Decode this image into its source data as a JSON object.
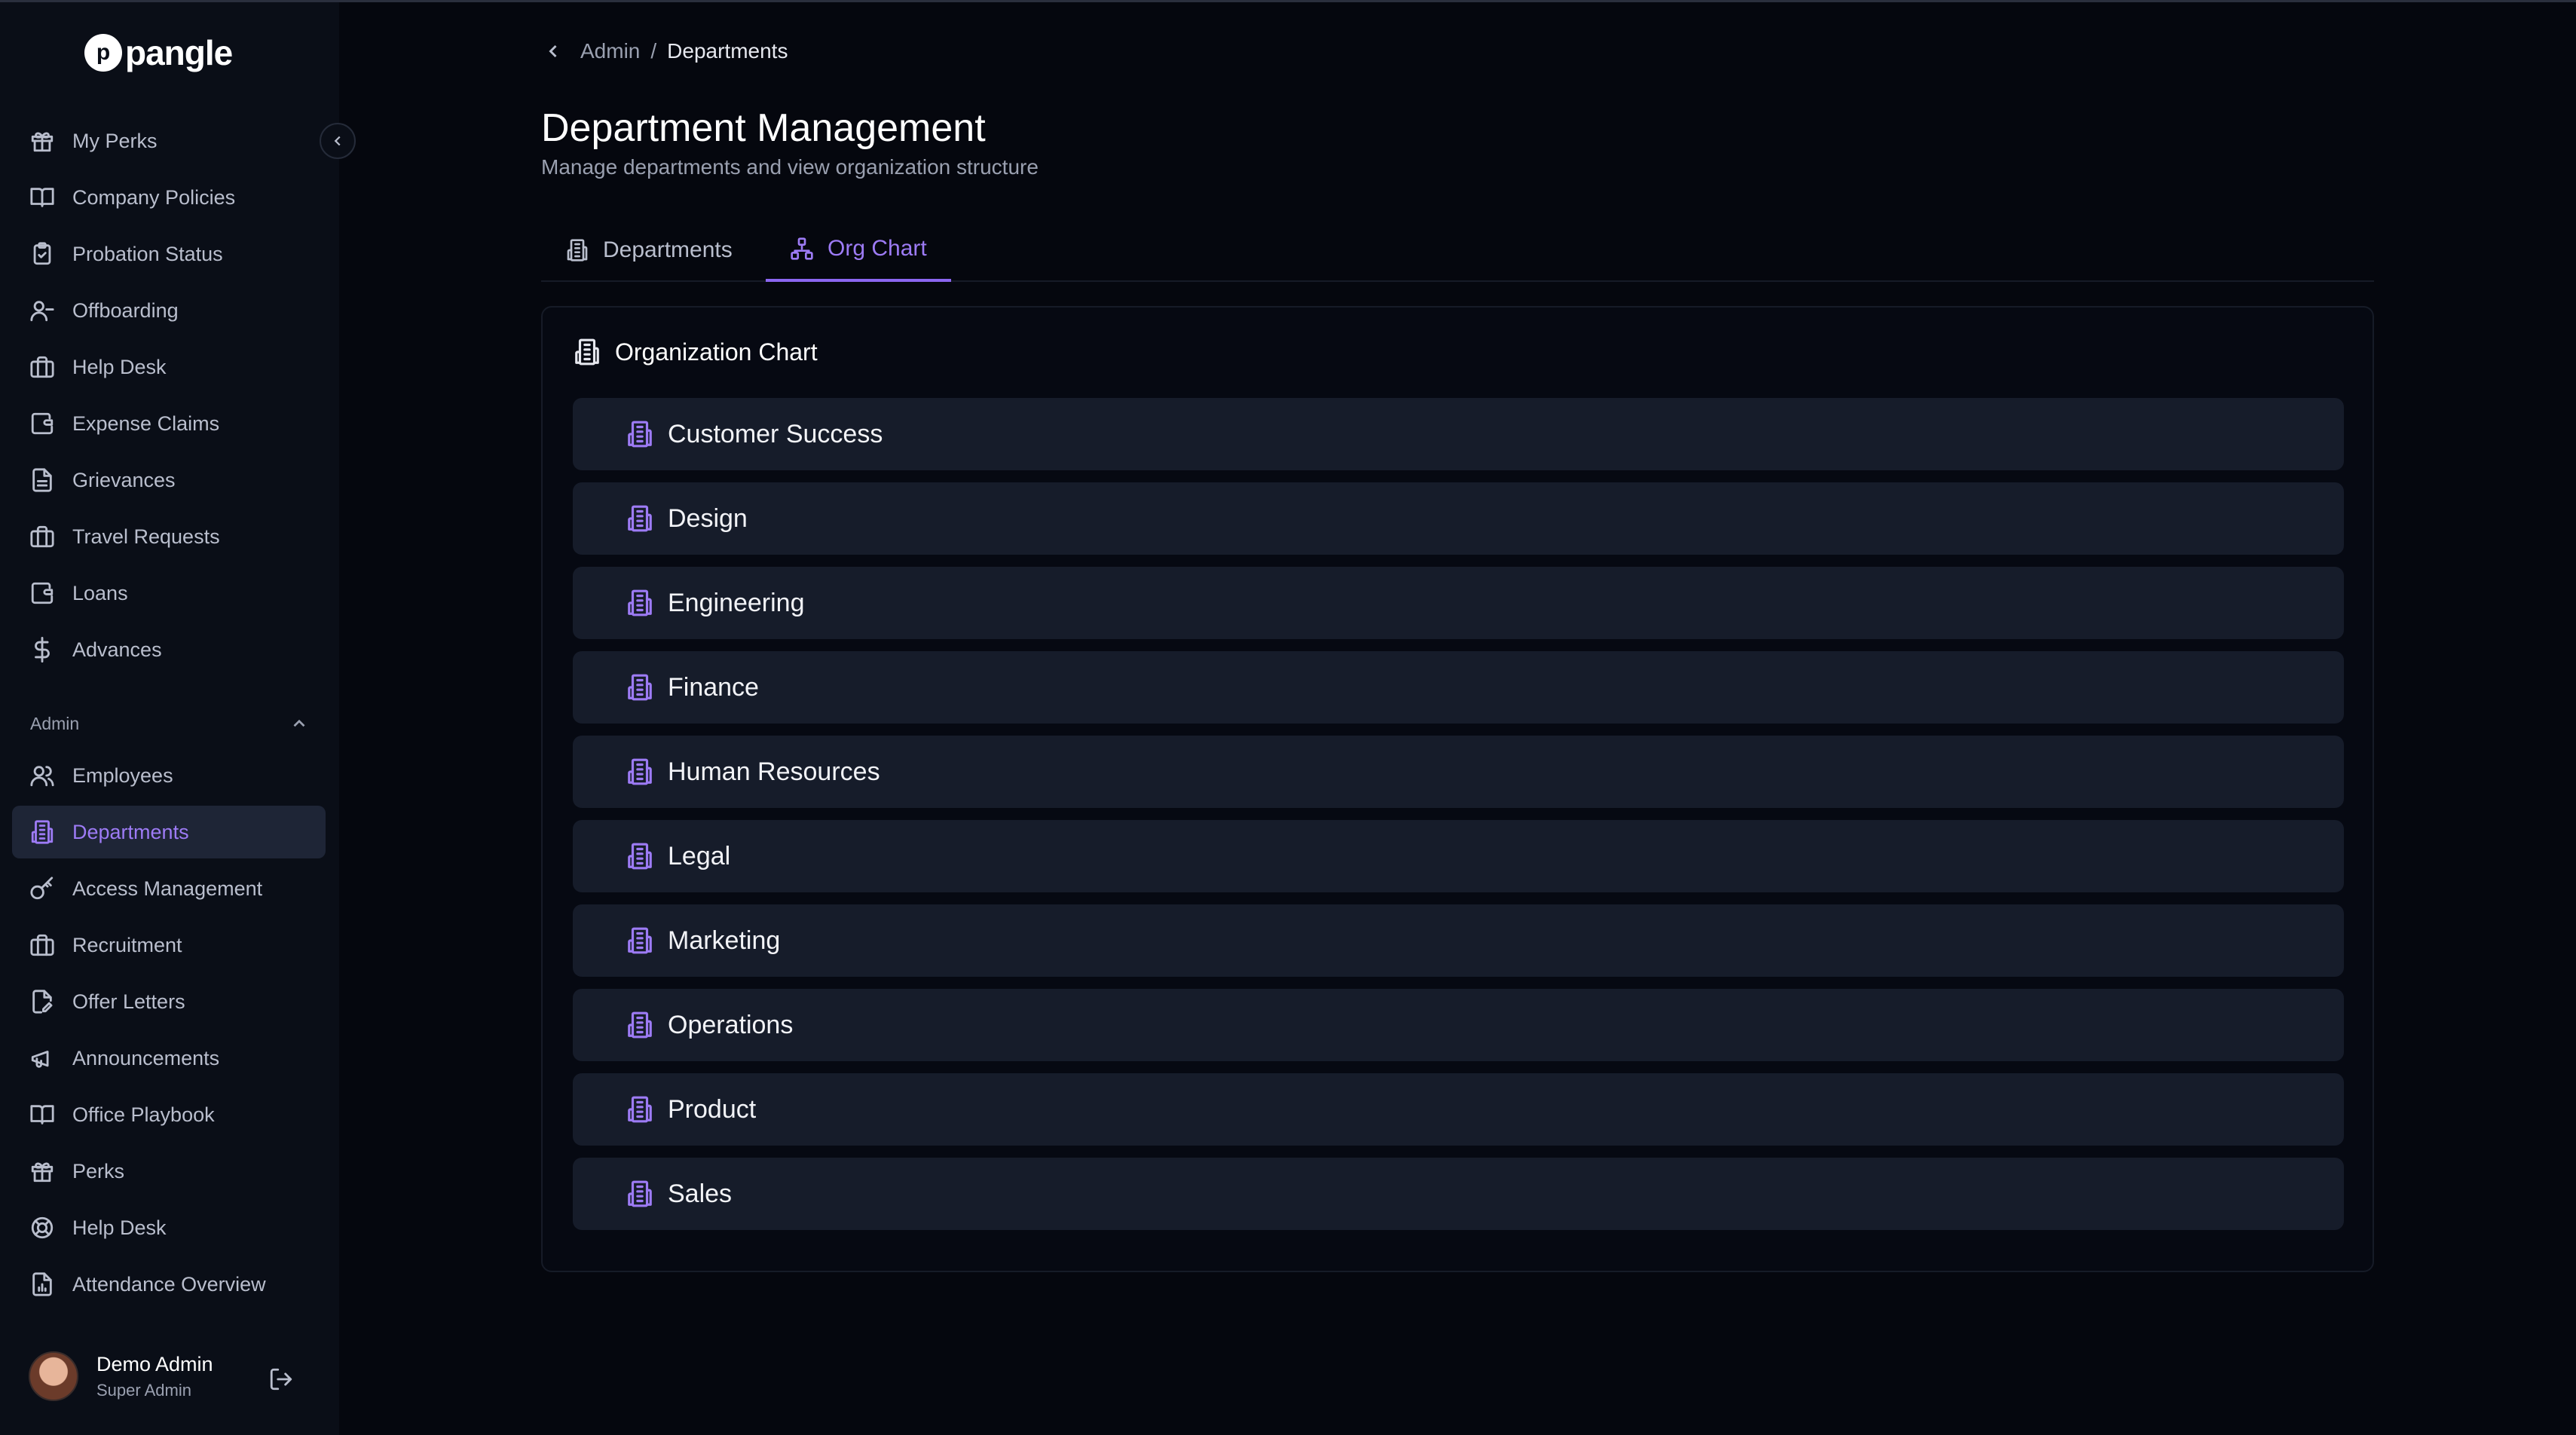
{
  "app": {
    "logo_text": "pangle",
    "logo_mark": "p"
  },
  "sidebar": {
    "items": [
      {
        "label": "My Perks",
        "icon": "gift-icon"
      },
      {
        "label": "Company Policies",
        "icon": "book-icon"
      },
      {
        "label": "Probation Status",
        "icon": "clipboard-check-icon"
      },
      {
        "label": "Offboarding",
        "icon": "user-minus-icon"
      },
      {
        "label": "Help Desk",
        "icon": "briefcase-icon"
      },
      {
        "label": "Expense Claims",
        "icon": "wallet-icon"
      },
      {
        "label": "Grievances",
        "icon": "file-text-icon"
      },
      {
        "label": "Travel Requests",
        "icon": "briefcase-icon"
      },
      {
        "label": "Loans",
        "icon": "wallet-icon"
      },
      {
        "label": "Advances",
        "icon": "dollar-icon"
      }
    ],
    "admin_section_label": "Admin",
    "admin_items": [
      {
        "label": "Employees",
        "icon": "users-icon"
      },
      {
        "label": "Departments",
        "icon": "building-icon",
        "active": true
      },
      {
        "label": "Access Management",
        "icon": "key-icon"
      },
      {
        "label": "Recruitment",
        "icon": "briefcase-icon"
      },
      {
        "label": "Offer Letters",
        "icon": "file-edit-icon"
      },
      {
        "label": "Announcements",
        "icon": "megaphone-icon"
      },
      {
        "label": "Office Playbook",
        "icon": "book-icon"
      },
      {
        "label": "Perks",
        "icon": "gift-icon"
      },
      {
        "label": "Help Desk",
        "icon": "life-buoy-icon"
      },
      {
        "label": "Attendance Overview",
        "icon": "file-chart-icon"
      }
    ],
    "user": {
      "name": "Demo Admin",
      "role": "Super Admin"
    }
  },
  "breadcrumb": {
    "parent": "Admin",
    "separator": "/",
    "current": "Departments"
  },
  "header": {
    "title": "Department Management",
    "subtitle": "Manage departments and view organization structure"
  },
  "tabs": [
    {
      "label": "Departments",
      "active": false
    },
    {
      "label": "Org Chart",
      "active": true
    }
  ],
  "org_chart": {
    "title": "Organization Chart",
    "departments": [
      "Customer Success",
      "Design",
      "Engineering",
      "Finance",
      "Human Resources",
      "Legal",
      "Marketing",
      "Operations",
      "Product",
      "Sales"
    ]
  },
  "colors": {
    "accent": "#9d7bf5",
    "background": "#05070e",
    "sidebar": "#0a0e17",
    "row": "#161c2a"
  }
}
